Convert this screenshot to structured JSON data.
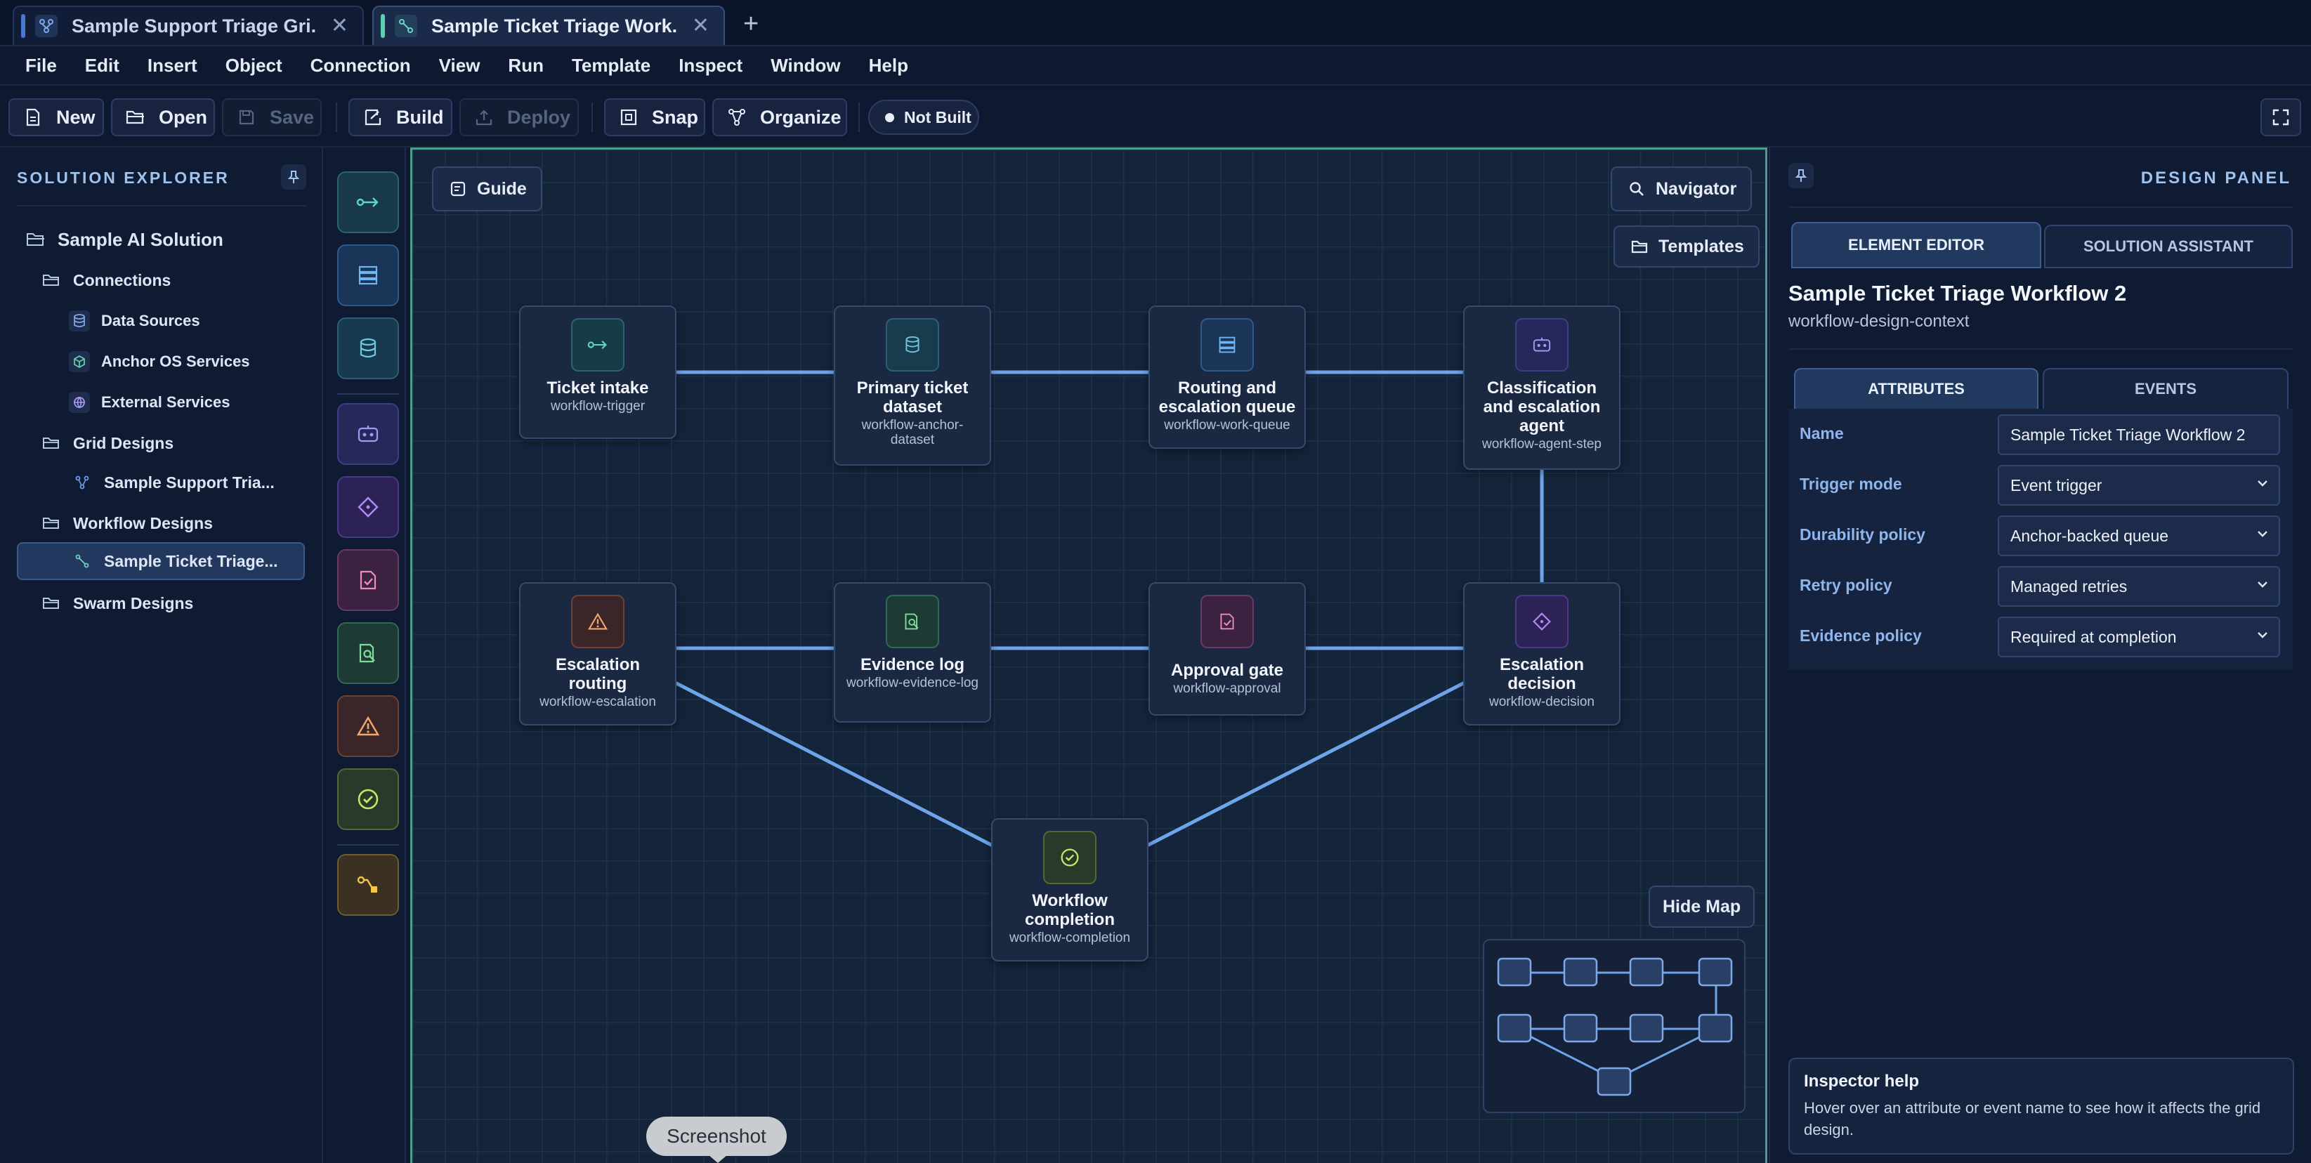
{
  "tabs": [
    {
      "title": "Sample Support Triage Gri...",
      "close": "✕",
      "active": false
    },
    {
      "title": "Sample Ticket Triage Work...",
      "close": "✕",
      "active": true
    }
  ],
  "new_tab": "+",
  "menu": [
    "File",
    "Edit",
    "Insert",
    "Object",
    "Connection",
    "View",
    "Run",
    "Template",
    "Inspect",
    "Window",
    "Help"
  ],
  "toolbar": {
    "new": "New",
    "open": "Open",
    "save": "Save",
    "build": "Build",
    "deploy": "Deploy",
    "snap": "Snap",
    "organize": "Organize",
    "status": "Not Built"
  },
  "explorer": {
    "title": "SOLUTION EXPLORER",
    "items": [
      {
        "label": "Sample AI Solution",
        "icon": "folder-open-icon"
      },
      {
        "label": "Connections",
        "icon": "folder-icon"
      },
      {
        "label": "Data Sources",
        "icon": "database-icon"
      },
      {
        "label": "Anchor OS Services",
        "icon": "cube-icon"
      },
      {
        "label": "External Services",
        "icon": "globe-icon"
      },
      {
        "label": "Grid Designs",
        "icon": "folder-icon"
      },
      {
        "label": "Sample Support Tria...",
        "icon": "grid-design-icon"
      },
      {
        "label": "Workflow Designs",
        "icon": "folder-icon"
      },
      {
        "label": "Sample Ticket Triage...",
        "icon": "workflow-icon"
      },
      {
        "label": "Swarm Designs",
        "icon": "folder-icon"
      }
    ]
  },
  "palette": [
    {
      "icon": "trigger-icon",
      "color": "#5fd6c8"
    },
    {
      "icon": "queue-icon",
      "color": "#6fb5f2"
    },
    {
      "icon": "dataset-icon",
      "color": "#6fc7e0"
    },
    {
      "icon": "agent-icon",
      "color": "#a39af5"
    },
    {
      "icon": "decision-icon",
      "color": "#b48af5"
    },
    {
      "icon": "approval-icon",
      "color": "#f08ab6"
    },
    {
      "icon": "evidence-icon",
      "color": "#7fdc9c"
    },
    {
      "icon": "warning-icon",
      "color": "#f3a86b"
    },
    {
      "icon": "completion-icon",
      "color": "#c6e66a"
    },
    {
      "icon": "connector-icon",
      "color": "#f2c64a"
    }
  ],
  "canvas": {
    "guide": "Guide",
    "navigator": "Navigator",
    "templates": "Templates",
    "hide_map": "Hide Map",
    "nodes": [
      {
        "title": "Ticket intake",
        "sub": "workflow-trigger"
      },
      {
        "title": "Primary ticket dataset",
        "sub": "workflow-anchor-dataset"
      },
      {
        "title": "Routing and escalation queue",
        "sub": "workflow-work-queue"
      },
      {
        "title": "Classification and escalation agent",
        "sub": "workflow-agent-step"
      },
      {
        "title": "Escalation routing",
        "sub": "workflow-escalation"
      },
      {
        "title": "Evidence log",
        "sub": "workflow-evidence-log"
      },
      {
        "title": "Approval gate",
        "sub": "workflow-approval"
      },
      {
        "title": "Escalation decision",
        "sub": "workflow-decision"
      },
      {
        "title": "Workflow completion",
        "sub": "workflow-completion"
      }
    ]
  },
  "screenshot_label": "Screenshot",
  "design_panel": {
    "title": "DESIGN PANEL",
    "tabs": [
      "ELEMENT EDITOR",
      "SOLUTION ASSISTANT"
    ],
    "heading": "Sample Ticket Triage Workflow 2",
    "subheading": "workflow-design-context",
    "subtabs": [
      "ATTRIBUTES",
      "EVENTS"
    ],
    "attributes": [
      {
        "label": "Name",
        "value": "Sample Ticket Triage Workflow 2",
        "type": "text"
      },
      {
        "label": "Trigger mode",
        "value": "Event trigger",
        "type": "select"
      },
      {
        "label": "Durability policy",
        "value": "Anchor-backed queue",
        "type": "select"
      },
      {
        "label": "Retry policy",
        "value": "Managed retries",
        "type": "select"
      },
      {
        "label": "Evidence policy",
        "value": "Required at completion",
        "type": "select"
      }
    ],
    "help": {
      "title": "Inspector help",
      "text": "Hover over an attribute or event name to see how it affects the grid design."
    }
  }
}
